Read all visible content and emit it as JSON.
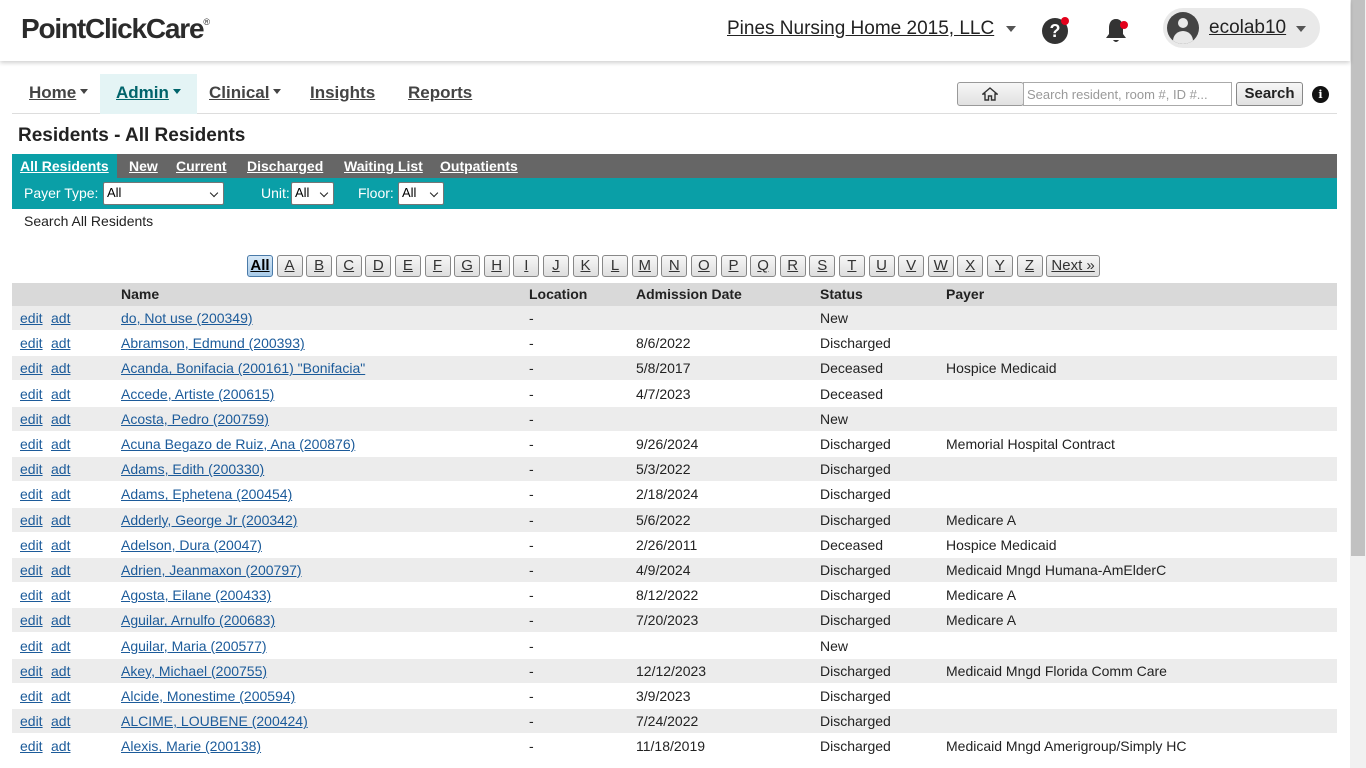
{
  "header": {
    "logo": "PointClickCare",
    "logo_mark": "®",
    "facility": "Pines Nursing Home 2015, LLC",
    "username": "ecolab10"
  },
  "nav": {
    "items": [
      {
        "label": "Home",
        "dropdown": true
      },
      {
        "label": "Admin",
        "dropdown": true,
        "active": true
      },
      {
        "label": "Clinical",
        "dropdown": true
      },
      {
        "label": "Insights",
        "dropdown": false
      },
      {
        "label": "Reports",
        "dropdown": false
      }
    ],
    "search_placeholder": "Search resident, room #, ID #...",
    "search_label": "Search",
    "info_glyph": "i",
    "help_glyph": "?"
  },
  "page": {
    "title": "Residents - All Residents"
  },
  "tabs": [
    "All Residents",
    "New",
    "Current",
    "Discharged",
    "Waiting List",
    "Outpatients"
  ],
  "filters": {
    "payer_label": "Payer Type:",
    "payer_value": "All",
    "unit_label": "Unit:",
    "unit_value": "All",
    "floor_label": "Floor:",
    "floor_value": "All"
  },
  "search_all_text": "Search All Residents",
  "alphabet": [
    "All",
    "A",
    "B",
    "C",
    "D",
    "E",
    "F",
    "G",
    "H",
    "I",
    "J",
    "K",
    "L",
    "M",
    "N",
    "O",
    "P",
    "Q",
    "R",
    "S",
    "T",
    "U",
    "V",
    "W",
    "X",
    "Y",
    "Z"
  ],
  "next_label": "Next »",
  "table": {
    "columns": [
      "Name",
      "Location",
      "Admission Date",
      "Status",
      "Payer"
    ],
    "edit_label": "edit",
    "adt_label": "adt",
    "rows": [
      {
        "name": "do, Not use (200349)",
        "location": "-",
        "admission": "",
        "status": "New",
        "payer": ""
      },
      {
        "name": "Abramson, Edmund (200393)",
        "location": "-",
        "admission": "8/6/2022",
        "status": "Discharged",
        "payer": ""
      },
      {
        "name": "Acanda, Bonifacia (200161) \"Bonifacia\"",
        "location": "-",
        "admission": "5/8/2017",
        "status": "Deceased",
        "payer": "Hospice Medicaid"
      },
      {
        "name": "Accede, Artiste (200615)",
        "location": "-",
        "admission": "4/7/2023",
        "status": "Deceased",
        "payer": ""
      },
      {
        "name": "Acosta, Pedro (200759)",
        "location": "-",
        "admission": "",
        "status": "New",
        "payer": ""
      },
      {
        "name": "Acuna Begazo de Ruiz, Ana (200876)",
        "location": "-",
        "admission": "9/26/2024",
        "status": "Discharged",
        "payer": "Memorial Hospital Contract"
      },
      {
        "name": "Adams, Edith (200330)",
        "location": "-",
        "admission": "5/3/2022",
        "status": "Discharged",
        "payer": ""
      },
      {
        "name": "Adams, Ephetena (200454)",
        "location": "-",
        "admission": "2/18/2024",
        "status": "Discharged",
        "payer": ""
      },
      {
        "name": "Adderly, George Jr (200342)",
        "location": "-",
        "admission": "5/6/2022",
        "status": "Discharged",
        "payer": "Medicare A"
      },
      {
        "name": "Adelson, Dura (20047)",
        "location": "-",
        "admission": "2/26/2011",
        "status": "Deceased",
        "payer": "Hospice Medicaid"
      },
      {
        "name": "Adrien, Jeanmaxon (200797)",
        "location": "-",
        "admission": "4/9/2024",
        "status": "Discharged",
        "payer": "Medicaid Mngd Humana-AmElderC"
      },
      {
        "name": "Agosta, Eilane (200433)",
        "location": "-",
        "admission": "8/12/2022",
        "status": "Discharged",
        "payer": "Medicare A"
      },
      {
        "name": "Aguilar, Arnulfo (200683)",
        "location": "-",
        "admission": "7/20/2023",
        "status": "Discharged",
        "payer": "Medicare A"
      },
      {
        "name": "Aguilar, Maria (200577)",
        "location": "-",
        "admission": "",
        "status": "New",
        "payer": ""
      },
      {
        "name": "Akey, Michael (200755)",
        "location": "-",
        "admission": "12/12/2023",
        "status": "Discharged",
        "payer": "Medicaid Mngd Florida Comm Care"
      },
      {
        "name": "Alcide, Monestime (200594)",
        "location": "-",
        "admission": "3/9/2023",
        "status": "Discharged",
        "payer": ""
      },
      {
        "name": "ALCIME, LOUBENE (200424)",
        "location": "-",
        "admission": "7/24/2022",
        "status": "Discharged",
        "payer": ""
      },
      {
        "name": "Alexis, Marie (200138)",
        "location": "-",
        "admission": "11/18/2019",
        "status": "Discharged",
        "payer": "Medicaid Mngd Amerigroup/Simply HC"
      }
    ]
  }
}
